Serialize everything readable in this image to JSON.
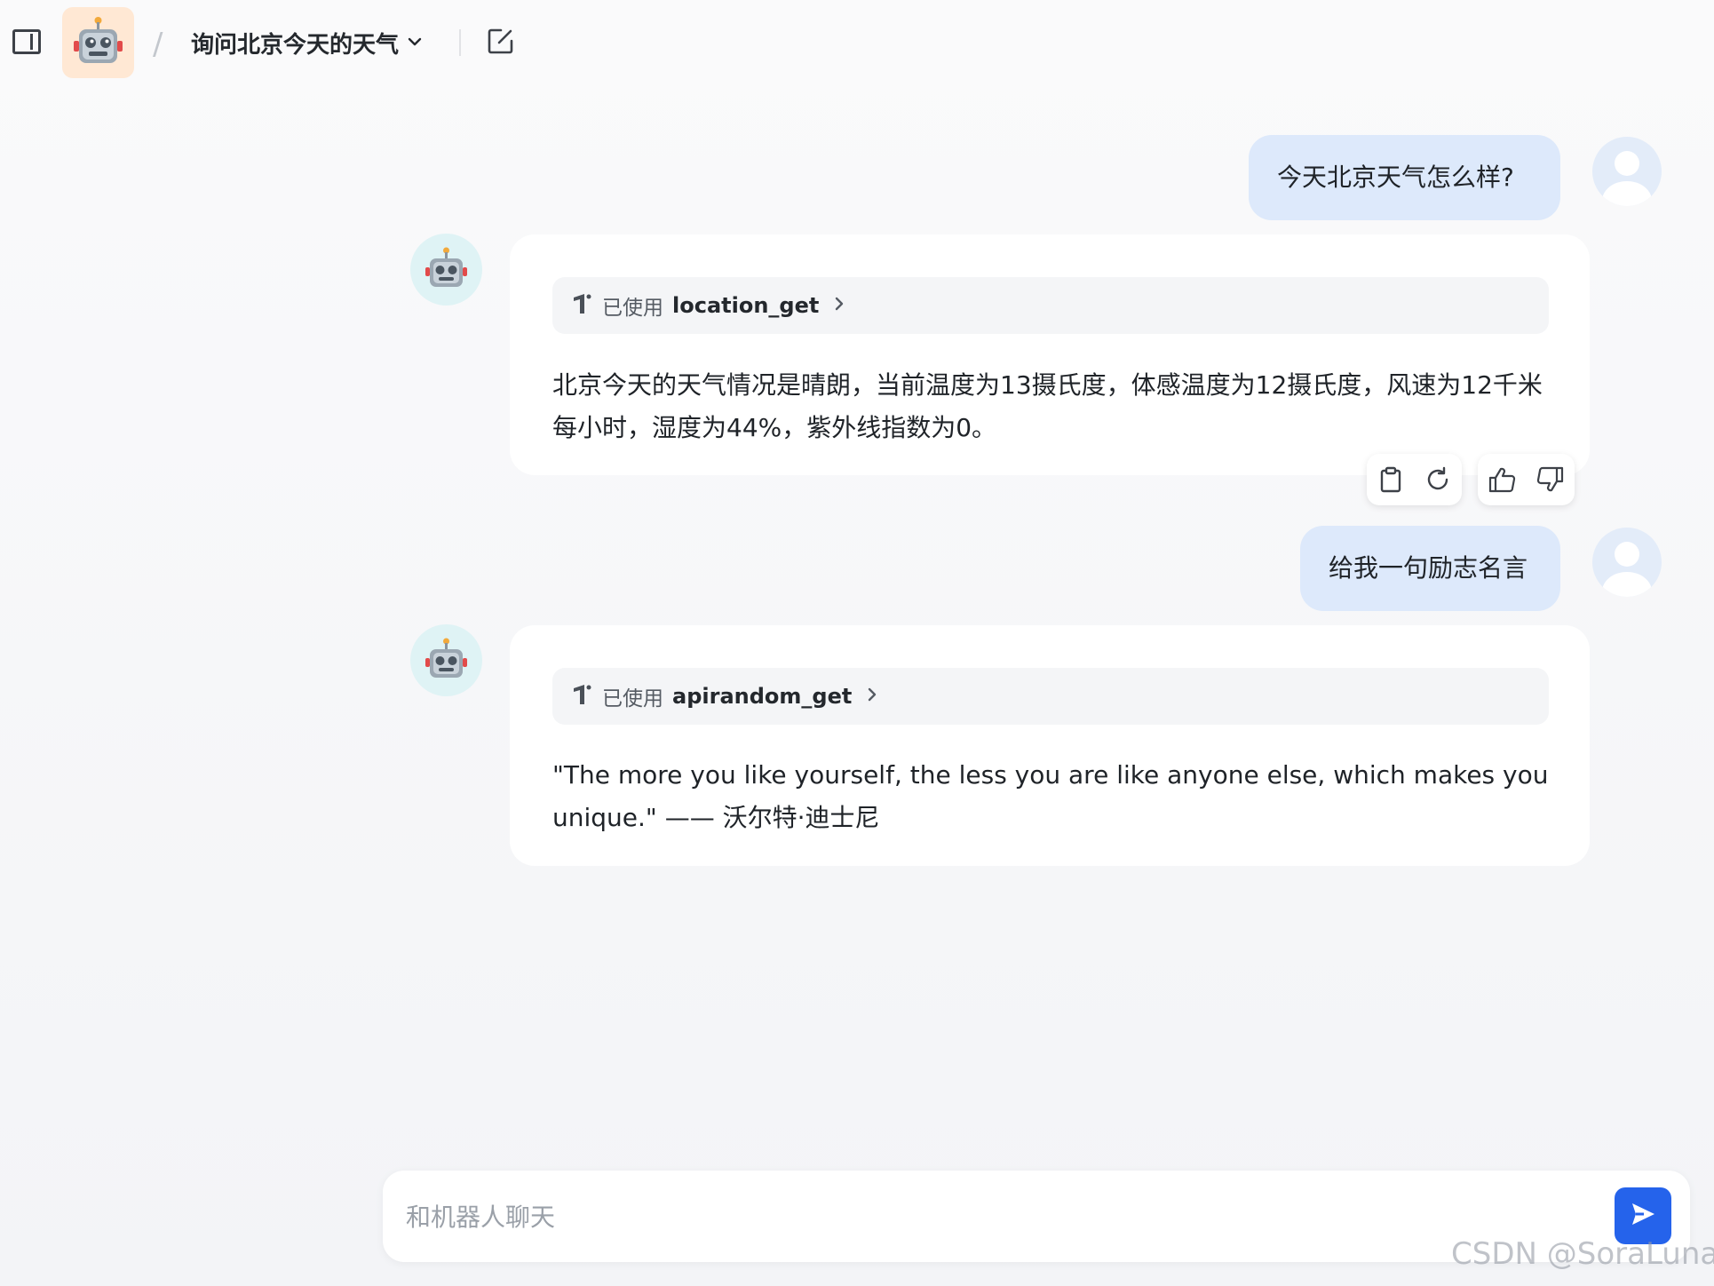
{
  "header": {
    "separator": "/",
    "conversation_title": "询问北京今天的天气"
  },
  "messages": [
    {
      "role": "user",
      "text": "今天北京天气怎么样?"
    },
    {
      "role": "bot",
      "tool_used_label": "已使用",
      "tool_name": "location_get",
      "text": "北京今天的天气情况是晴朗，当前温度为13摄氏度，体感温度为12摄氏度，风速为12千米每小时，湿度为44%，紫外线指数为0。"
    },
    {
      "role": "user",
      "text": "给我一句励志名言"
    },
    {
      "role": "bot",
      "tool_used_label": "已使用",
      "tool_name": "apirandom_get",
      "text": "\"The more you like yourself, the less you are like anyone else, which makes you unique.\" —— 沃尔特·迪士尼"
    }
  ],
  "message_actions": [
    "copy-icon",
    "regenerate-icon",
    "thumbs-up-icon",
    "thumbs-down-icon"
  ],
  "composer": {
    "placeholder": "和机器人聊天",
    "value": ""
  },
  "watermark": "CSDN @SoraLuna",
  "colors": {
    "accent": "#2563eb",
    "user_bubble": "#dde9fb",
    "bot_avatar_bg": "#dff3f5",
    "app_icon_bg": "#ffe8d4"
  }
}
